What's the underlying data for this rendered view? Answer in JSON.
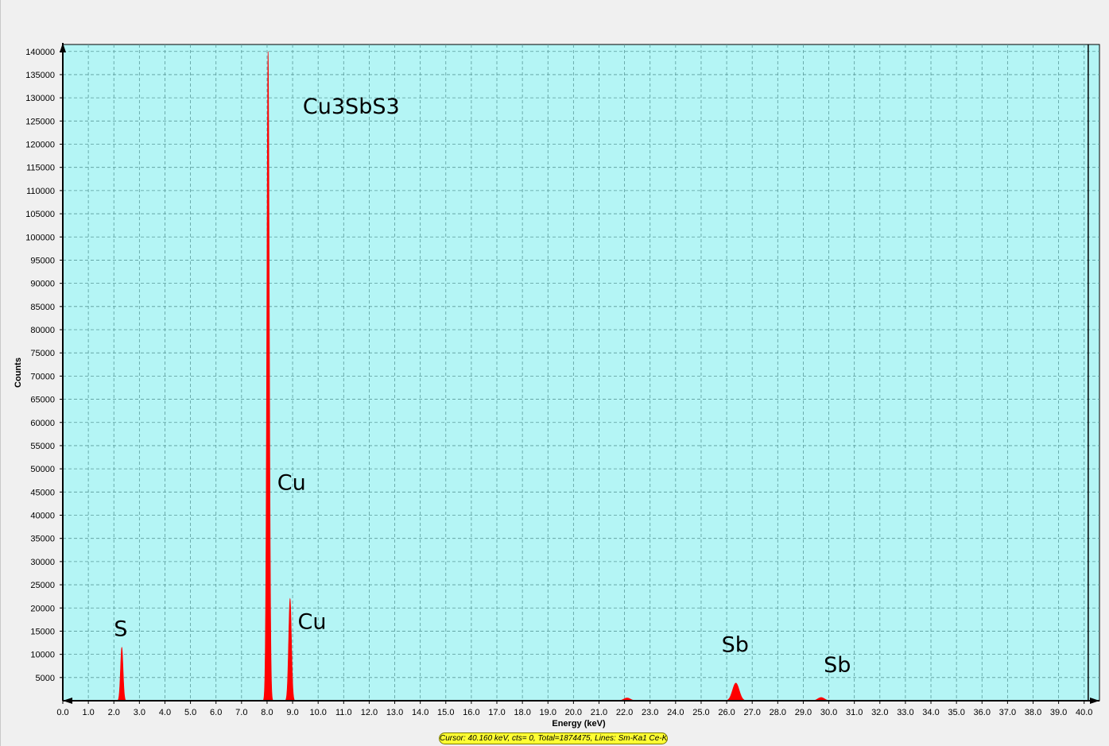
{
  "chart_data": {
    "type": "area",
    "title": "Cu3SbS3",
    "xlabel": "Energy (keV)",
    "ylabel": "Counts",
    "xlim": [
      0.0,
      40.6
    ],
    "ylim": [
      0,
      141500
    ],
    "x_ticks": [
      0.0,
      1.0,
      2.0,
      3.0,
      4.0,
      5.0,
      6.0,
      7.0,
      8.0,
      9.0,
      10.0,
      11.0,
      12.0,
      13.0,
      14.0,
      15.0,
      16.0,
      17.0,
      18.0,
      19.0,
      20.0,
      21.0,
      22.0,
      23.0,
      24.0,
      25.0,
      26.0,
      27.0,
      28.0,
      29.0,
      30.0,
      31.0,
      32.0,
      33.0,
      34.0,
      35.0,
      36.0,
      37.0,
      38.0,
      39.0,
      40.0
    ],
    "y_ticks": [
      5000,
      10000,
      15000,
      20000,
      25000,
      30000,
      35000,
      40000,
      45000,
      50000,
      55000,
      60000,
      65000,
      70000,
      75000,
      80000,
      85000,
      90000,
      95000,
      100000,
      105000,
      110000,
      115000,
      120000,
      125000,
      130000,
      135000,
      140000
    ],
    "grid": true,
    "peaks": [
      {
        "element": "S",
        "energy": 2.31,
        "counts": 11500
      },
      {
        "element": "Cu",
        "energy": 8.04,
        "counts": 140000
      },
      {
        "element": "Cu",
        "energy": 8.9,
        "counts": 22000
      },
      {
        "element": "",
        "energy": 22.1,
        "counts": 600
      },
      {
        "element": "Sb",
        "energy": 26.36,
        "counts": 3800
      },
      {
        "element": "Sb",
        "energy": 29.7,
        "counts": 700
      }
    ],
    "labels": [
      {
        "text": "S",
        "energy": 2.0,
        "counts": 14000
      },
      {
        "text": "Cu",
        "energy": 8.4,
        "counts": 45500
      },
      {
        "text": "Cu",
        "energy": 9.2,
        "counts": 15500
      },
      {
        "text": "Sb",
        "energy": 25.8,
        "counts": 10500
      },
      {
        "text": "Sb",
        "energy": 29.8,
        "counts": 6200
      }
    ],
    "colors": {
      "plot_background": "#b4f5f5",
      "spectrum": "#ff0000",
      "grid": "#5a9a9a"
    }
  },
  "status_bar": {
    "text": "Cursor: 40.160 keV, cts= 0, Total=1874475, Lines: Sm-Ka1 Ce-Kb2"
  }
}
